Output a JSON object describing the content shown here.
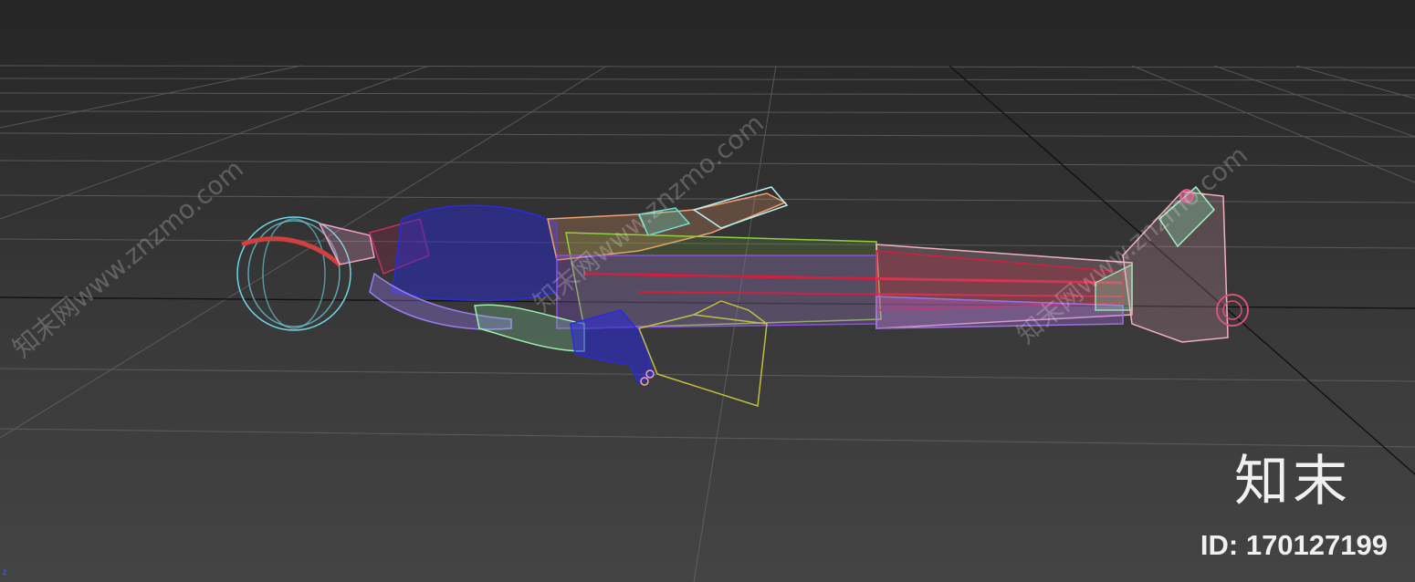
{
  "viewport": {
    "name": "3d-viewport",
    "content": "wireframe-reclining-human-model",
    "background_color": "#2c2c2c",
    "grid_color": "#5a5a5a"
  },
  "watermarks": [
    "知末网www.znzmo.com",
    "知末网www.znzmo.com",
    "知末网www.znzmo.com"
  ],
  "branding": {
    "logo_text": "知末",
    "id_text": "ID: 170127199"
  },
  "axis_indicator": {
    "label": "z"
  }
}
